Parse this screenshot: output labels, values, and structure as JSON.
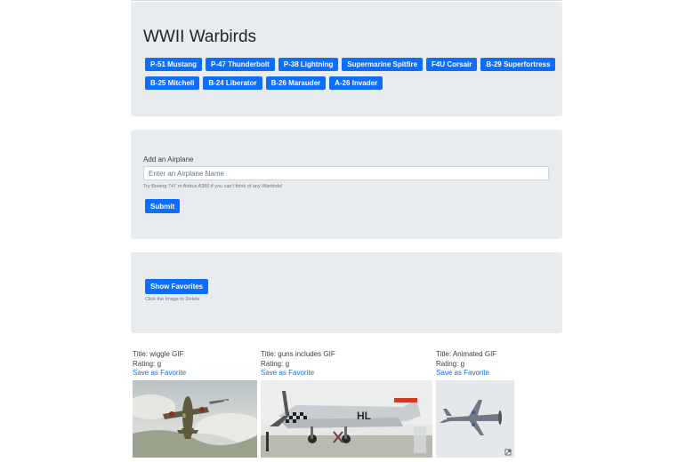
{
  "header": {
    "title": "WWII Warbirds",
    "warbirds": [
      "P-51 Mustang",
      "P-47 Thunderbolt",
      "P-38 Lightning",
      "Supermarine Spitfire",
      "F4U Corsair",
      "B-29 Superfortress",
      "B-25 Mitchell",
      "B-24 Liberator",
      "B-26 Marauder",
      "A-26 Invader"
    ]
  },
  "add_form": {
    "label": "Add an Airplane",
    "placeholder": "Enter an Airplane Name",
    "hint": "Try Boeing 747 or Airbus A380 if you can't think of any Warbirds!",
    "submit_label": "Submit"
  },
  "favorites": {
    "button_label": "Show Favorites",
    "hint": "Click the Image to Delete"
  },
  "gifs": [
    {
      "title": "Title: wiggle GIF",
      "rating": "Rating: g",
      "save": "Save as Favorite"
    },
    {
      "title": "Title: guns includes GIF",
      "rating": "Rating: g",
      "save": "Save as Favorite"
    },
    {
      "title": "Title: Animated GIF",
      "rating": "Rating: g",
      "save": "Save as Favorite"
    }
  ],
  "colors": {
    "primary": "#0d6efd",
    "panel": "#e9ecef"
  }
}
